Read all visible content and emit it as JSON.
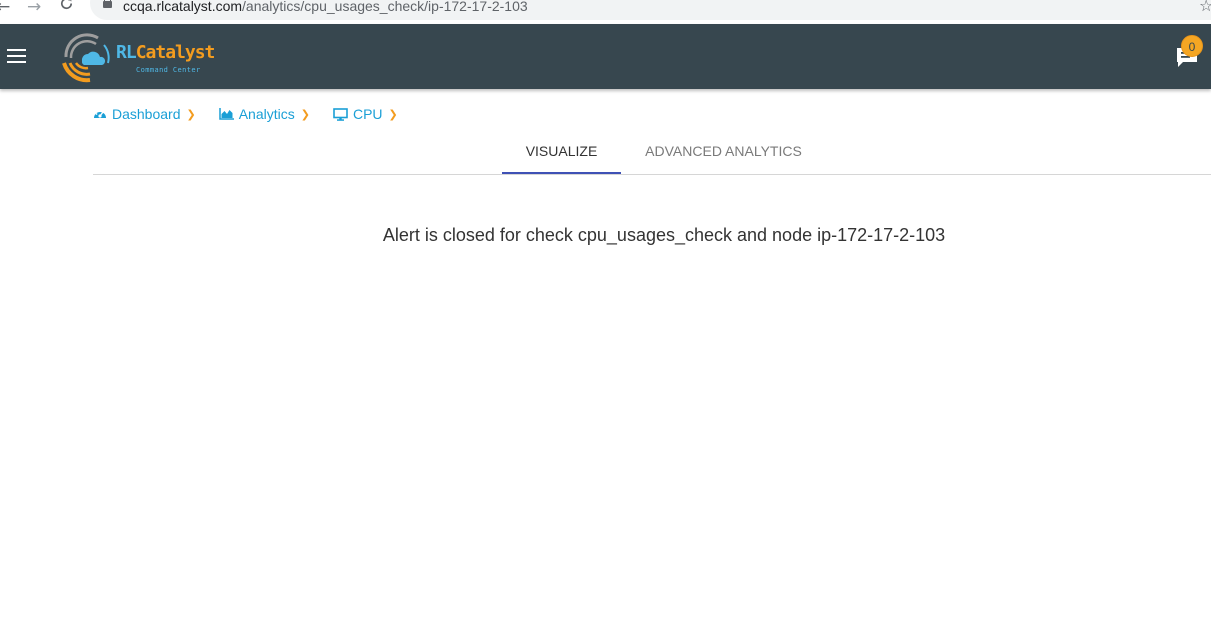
{
  "browser": {
    "url_host": "ccqa.rlcatalyst.com",
    "url_path": "/analytics/cpu_usages_check/ip-172-17-2-103",
    "icons": [
      "back-arrow-icon",
      "forward-arrow-icon",
      "reload-icon",
      "lock-icon",
      "star-icon"
    ]
  },
  "header": {
    "logo": {
      "brand_rl": "RL",
      "brand_catalyst": "Catalyst",
      "tagline": "Command Center"
    },
    "notifications": {
      "count": "0"
    },
    "colors": {
      "header_bg": "#37474f",
      "accent_blue": "#1a9fd6",
      "accent_orange": "#f39c1f",
      "badge": "#f5a623"
    }
  },
  "breadcrumb": {
    "items": [
      {
        "label": "Dashboard",
        "icon": "dashboard-gauge-icon"
      },
      {
        "label": "Analytics",
        "icon": "area-chart-icon"
      },
      {
        "label": "CPU",
        "icon": "desktop-icon"
      }
    ]
  },
  "tabs": {
    "items": [
      {
        "label": "VISUALIZE",
        "active": true
      },
      {
        "label": "ADVANCED ANALYTICS",
        "active": false
      }
    ],
    "indicator_color": "#3f51b5"
  },
  "main": {
    "message": "Alert is closed for check cpu_usages_check and node ip-172-17-2-103"
  }
}
